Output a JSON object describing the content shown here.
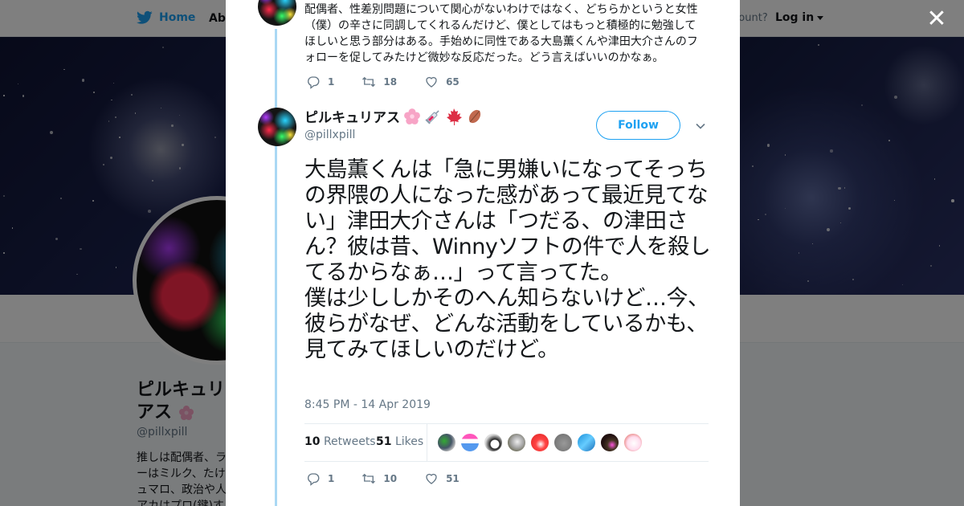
{
  "topnav": {
    "home_label": "Home",
    "about_label": "Abo",
    "account_prompt": "ccount?",
    "login_label": "Log in"
  },
  "profile": {
    "name": "ピルキュリアス",
    "handle": "@pillxpill",
    "bio_lines": [
      "推しは配偶者、ラ",
      "ーはミルク、たけ",
      "ュマロ、政治や人",
      "アカはプロ(鍵)す"
    ]
  },
  "previous_tweet": {
    "text": "配偶者、性差別問題について関心がないわけではなく、どちらかというと女性（僕）の辛さに同調してくれるんだけど、僕としてはもっと積極的に勉強してほしいと思う部分はある。手始めに同性である大島薫くんや津田大介さんのフォローを促してみたけど微妙な反応だった。どう言えばいいのかなぁ。",
    "replies": "1",
    "retweets": "18",
    "likes": "65"
  },
  "tweet": {
    "display_name": "ピルキュリアス",
    "handle": "@pillxpill",
    "follow_label": "Follow",
    "text": "大島薫くんは「急に男嫌いになってそっちの界隈の人になった感があって最近見てない」津田大介さんは「つだる、の津田さん？彼は昔、Winnyソフトの件で人を殺してるからなぁ…」って言ってた。\n僕は少ししかそのへん知らないけど…今、彼らがなぜ、どんな活動をしているかも、見てみてほしいのだけど。",
    "timestamp": "8:45 PM - 14 Apr 2019",
    "retweet_count": "10",
    "retweet_label": "Retweets",
    "like_count": "51",
    "like_label": "Likes",
    "replies": "1",
    "retweets": "10",
    "likes": "51"
  },
  "icons": {
    "close": "close-icon",
    "reply": "reply-icon",
    "retweet": "retweet-icon",
    "like": "heart-icon",
    "caret": "chevron-down-icon",
    "brand": "twitter-bird-icon"
  },
  "colors": {
    "accent": "#1da1f2",
    "thread_line": "#aad8f4",
    "text": "#14171a",
    "muted": "#657786"
  }
}
